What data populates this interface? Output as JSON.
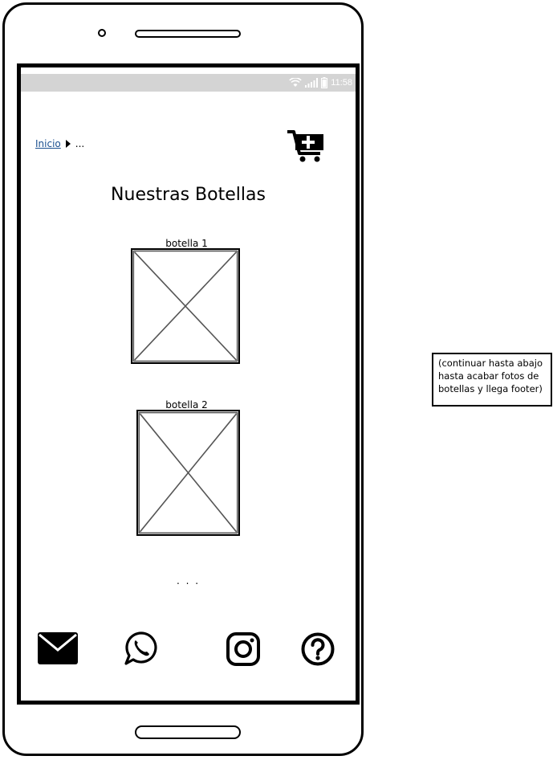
{
  "status_bar": {
    "time": "11:58"
  },
  "breadcrumb": {
    "home_label": "Inicio",
    "current": "..."
  },
  "page": {
    "title": "Nuestras Botellas"
  },
  "bottles": [
    {
      "label": "botella 1"
    },
    {
      "label": "botella 2"
    }
  ],
  "more_indicator": ". . .",
  "footer": {
    "icons": [
      "envelope-icon",
      "whatsapp-icon",
      "instagram-icon",
      "help-icon"
    ]
  },
  "annotation": {
    "text": "(continuar hasta abajo hasta acabar fotos de botellas y llega footer)"
  },
  "colors": {
    "link": "#1a4f8f",
    "statusbar": "#d4d4d4"
  }
}
